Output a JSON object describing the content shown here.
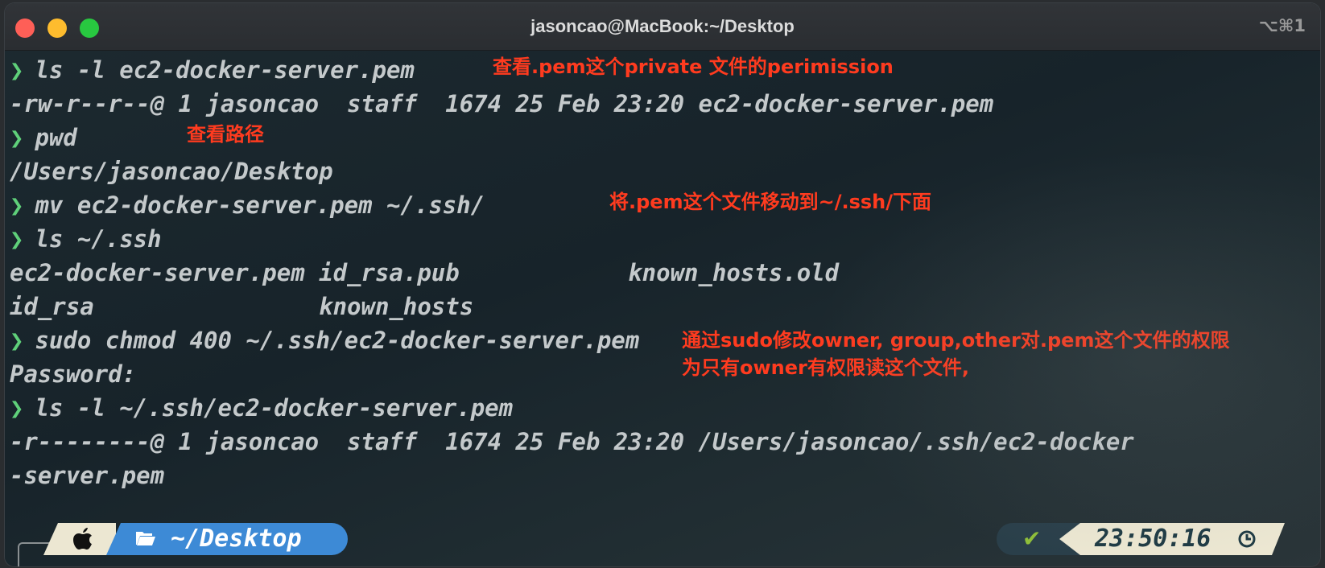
{
  "window": {
    "title": "jasoncao@MacBook:~/Desktop",
    "shortcut": "⌥⌘1"
  },
  "terminal": {
    "lines": [
      {
        "type": "cmd",
        "text": "ls -l ec2-docker-server.pem"
      },
      {
        "type": "out",
        "text": "-rw-r--r--@ 1 jasoncao  staff  1674 25 Feb 23:20 ec2-docker-server.pem"
      },
      {
        "type": "cmd",
        "text": "pwd"
      },
      {
        "type": "out",
        "text": "/Users/jasoncao/Desktop"
      },
      {
        "type": "cmd",
        "text": "mv ec2-docker-server.pem ~/.ssh/"
      },
      {
        "type": "cmd",
        "text": "ls ~/.ssh"
      },
      {
        "type": "out",
        "text": "ec2-docker-server.pem id_rsa.pub            known_hosts.old"
      },
      {
        "type": "out",
        "text": "id_rsa                known_hosts"
      },
      {
        "type": "cmd",
        "text": "sudo chmod 400 ~/.ssh/ec2-docker-server.pem"
      },
      {
        "type": "out",
        "text": "Password:"
      },
      {
        "type": "cmd",
        "text": "ls -l ~/.ssh/ec2-docker-server.pem"
      },
      {
        "type": "out",
        "text": "-r--------@ 1 jasoncao  staff  1674 25 Feb 23:20 /Users/jasoncao/.ssh/ec2-docker"
      },
      {
        "type": "out",
        "text": "-server.pem"
      }
    ],
    "prompt_symbol": "❯"
  },
  "annotations": {
    "note1": "查看.pem这个private 文件的perimission",
    "note2": "查看路径",
    "note3": "将.pem这个文件移动到~/.ssh/下面",
    "note4_line1": "通过sudo修改owner, group,other对.pem这个文件的权限",
    "note4_line2": "为只有owner有权限读这个文件,"
  },
  "statusbar": {
    "directory": "~/Desktop",
    "time": "23:50:16",
    "status_icon": "check-icon",
    "colors": {
      "dir_bg": "#3d8ad6",
      "apple_bg": "#ece7d2",
      "check": "#8fbf3a"
    }
  }
}
